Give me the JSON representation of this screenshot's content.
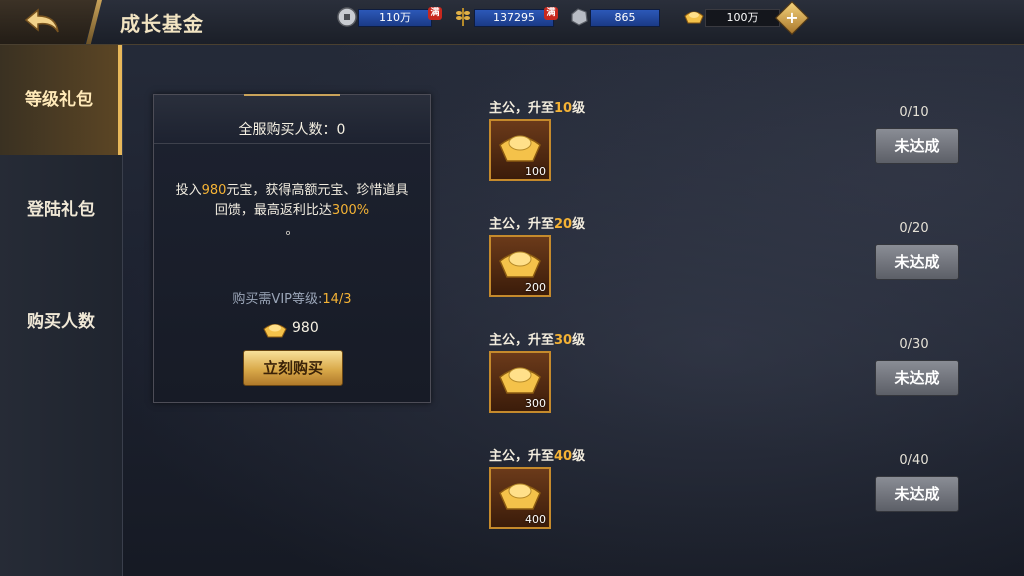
{
  "header": {
    "title": "成长基金",
    "resources": {
      "silver": {
        "value": "110万",
        "badge": "满",
        "color": "#2c58b8"
      },
      "grain": {
        "value": "137295",
        "badge": "满",
        "color": "#2c58b8"
      },
      "iron": {
        "value": "865",
        "color": "#2c58b8"
      },
      "gold": {
        "value": "100万"
      }
    }
  },
  "sidebar": {
    "items": [
      {
        "label": "等级礼包",
        "active": true
      },
      {
        "label": "登陆礼包",
        "active": false
      },
      {
        "label": "购买人数",
        "active": false
      }
    ]
  },
  "fund_card": {
    "buyers_label": "全服购买人数：0",
    "desc_prefix": "投入",
    "desc_amount": "980",
    "desc_mid": "元宝，获得高额元宝、珍惜道具回馈，最高返利比达",
    "desc_rate": "300%",
    "desc_suffix": "。",
    "vip_label": "购买需VIP等级:",
    "vip_value": "14/3",
    "price": "980",
    "buy_button": "立刻购买"
  },
  "rewards": [
    {
      "title_prefix": "主公，升至",
      "level": "10",
      "title_suffix": "级",
      "qty": "100",
      "progress": "0/10",
      "status": "未达成"
    },
    {
      "title_prefix": "主公，升至",
      "level": "20",
      "title_suffix": "级",
      "qty": "200",
      "progress": "0/20",
      "status": "未达成"
    },
    {
      "title_prefix": "主公，升至",
      "level": "30",
      "title_suffix": "级",
      "qty": "300",
      "progress": "0/30",
      "status": "未达成"
    },
    {
      "title_prefix": "主公，升至",
      "level": "40",
      "title_suffix": "级",
      "qty": "400",
      "progress": "0/40",
      "status": "未达成"
    }
  ],
  "colors": {
    "accent_gold": "#f5b335",
    "title": "#f2e4c2",
    "disabled_btn": "#6e7179"
  }
}
